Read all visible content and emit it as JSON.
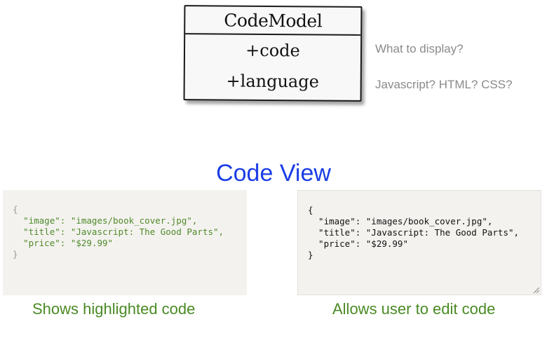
{
  "uml": {
    "class_name": "CodeModel",
    "attributes": [
      "+code",
      "+language"
    ]
  },
  "notes": {
    "code_note": "What to display?",
    "language_note": "Javascript? HTML? CSS?"
  },
  "view": {
    "title": "Code View"
  },
  "code": {
    "open": "{",
    "lines": [
      {
        "key": "\"image\"",
        "sep": ": ",
        "value": "\"images/book_cover.jpg\"",
        "end": ","
      },
      {
        "key": "\"title\"",
        "sep": ": ",
        "value": "\"Javascript: The Good Parts\"",
        "end": ","
      },
      {
        "key": "\"price\"",
        "sep": ": ",
        "value": "\"$29.99\"",
        "end": ""
      }
    ],
    "close": "}"
  },
  "editor_text": "{\n  \"image\": \"images/book_cover.jpg\",\n  \"title\": \"Javascript: The Good Parts\",\n  \"price\": \"$29.99\"\n}",
  "captions": {
    "left": "Shows highlighted code",
    "right": "Allows user to edit code"
  },
  "colors": {
    "title": "#1a3de6",
    "caption": "#4a8a24",
    "string": "#4e8a2a",
    "panel": "#f4f2ef"
  }
}
